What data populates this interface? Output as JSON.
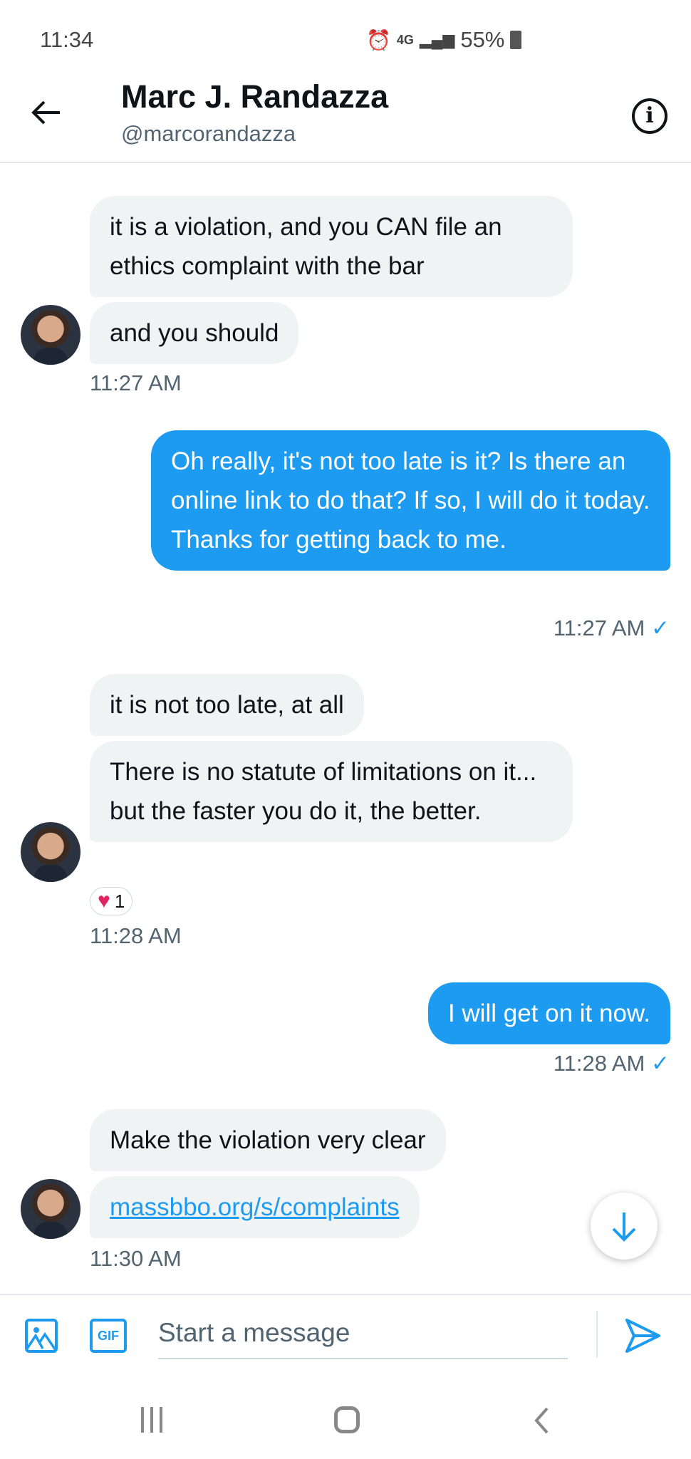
{
  "status_bar": {
    "time": "11:34",
    "network": "4G",
    "battery": "55%"
  },
  "header": {
    "name": "Marc J. Randazza",
    "handle": "@marcorandazza"
  },
  "messages": [
    {
      "text": "it is a violation, and you CAN file an ethics complaint with the bar"
    },
    {
      "text": "and you should"
    },
    {
      "time": "11:27 AM"
    },
    {
      "text": "Oh really, it's not too late is it? Is there an online link to do that? If so, I will do it today. Thanks for getting back to me."
    },
    {
      "time": "11:27 AM"
    },
    {
      "text": "it is not too late, at all"
    },
    {
      "text": "There is no statute of limitations on it... but the faster you do it, the better."
    },
    {
      "reaction_count": "1"
    },
    {
      "time": "11:28 AM"
    },
    {
      "text": "I will get on it now."
    },
    {
      "time": "11:28 AM"
    },
    {
      "text": "Make the violation very clear"
    },
    {
      "text": "massbbo.org/s/complaints"
    },
    {
      "time": "11:30 AM"
    }
  ],
  "composer": {
    "placeholder": "Start a message",
    "gif_label": "GIF"
  },
  "colors": {
    "accent": "#1d9bf0",
    "bubble_in": "#eff3f4"
  }
}
